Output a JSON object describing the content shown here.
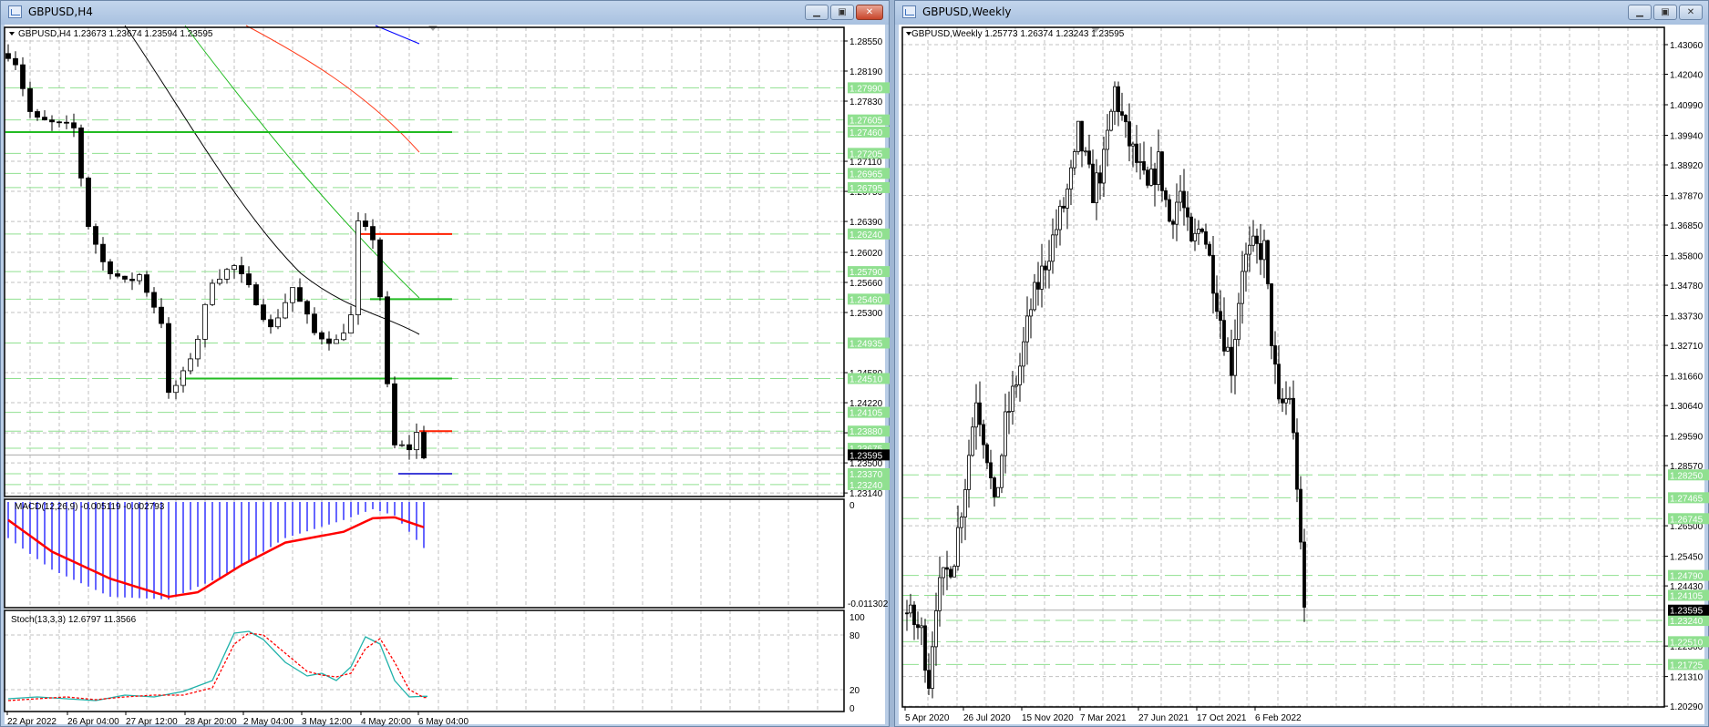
{
  "left_window": {
    "title": "GBPUSD,H4",
    "buttons": {
      "minimize": "▁",
      "restore": "▣",
      "close": "✕"
    },
    "info": "GBPUSD,H4  1.23673 1.23674 1.23594 1.23595",
    "price_ticks": [
      "1.28550",
      "1.28190",
      "1.27830",
      "1.27110",
      "1.26750",
      "1.26390",
      "1.26020",
      "1.25660",
      "1.25300",
      "1.24580",
      "1.24220",
      "1.23860",
      "1.23500",
      "1.23140"
    ],
    "level_labels": [
      "1.27990",
      "1.27605",
      "1.27460",
      "1.27205",
      "1.26965",
      "1.26795",
      "1.26240",
      "1.25790",
      "1.25460",
      "1.24935",
      "1.24510",
      "1.24105",
      "1.23880",
      "1.23675",
      "1.23370",
      "1.23240"
    ],
    "current_price": "1.23595",
    "time_labels": [
      "22 Apr 2022",
      "26 Apr 04:00",
      "27 Apr 12:00",
      "28 Apr 20:00",
      "2 May 04:00",
      "3 May 12:00",
      "4 May 20:00",
      "6 May 04:00"
    ],
    "price_path": [
      [
        0,
        1.284
      ],
      [
        1,
        1.283
      ],
      [
        3,
        1.277
      ],
      [
        4,
        1.276
      ],
      [
        9,
        1.275
      ],
      [
        11,
        1.2635
      ],
      [
        13,
        1.259
      ],
      [
        16,
        1.2565
      ],
      [
        18,
        1.2575
      ],
      [
        21,
        1.252
      ],
      [
        22,
        1.243
      ],
      [
        24,
        1.2455
      ],
      [
        26,
        1.25
      ],
      [
        28,
        1.257
      ],
      [
        31,
        1.2585
      ],
      [
        34,
        1.2545
      ],
      [
        36,
        1.251
      ],
      [
        39,
        1.256
      ],
      [
        42,
        1.2505
      ],
      [
        45,
        1.2495
      ],
      [
        47,
        1.2525
      ],
      [
        48,
        1.2635
      ],
      [
        50,
        1.262
      ],
      [
        51,
        1.255
      ],
      [
        52,
        1.244
      ],
      [
        53,
        1.237
      ],
      [
        55,
        1.2368
      ],
      [
        56,
        1.2385
      ],
      [
        57,
        1.23595
      ]
    ],
    "candle_count": 58,
    "macd": {
      "label": "MACD(12,26,9) -0.005119 -0.002793",
      "axis_top": "0",
      "axis_bottom": "-0.011302",
      "hist_path": [
        [
          0,
          -0.004
        ],
        [
          6,
          -0.0075
        ],
        [
          14,
          -0.0105
        ],
        [
          22,
          -0.0108
        ],
        [
          30,
          -0.008
        ],
        [
          38,
          -0.004
        ],
        [
          46,
          -0.002
        ],
        [
          50,
          -0.0008
        ],
        [
          53,
          -0.0015
        ],
        [
          57,
          -0.0051
        ]
      ],
      "signal_path": [
        [
          0,
          -0.002
        ],
        [
          6,
          -0.0055
        ],
        [
          14,
          -0.0085
        ],
        [
          22,
          -0.0105
        ],
        [
          26,
          -0.01
        ],
        [
          32,
          -0.007
        ],
        [
          38,
          -0.0045
        ],
        [
          46,
          -0.0033
        ],
        [
          50,
          -0.0018
        ],
        [
          53,
          -0.0017
        ],
        [
          57,
          -0.0028
        ]
      ]
    },
    "stoch": {
      "label": "Stoch(13,3,3) 12.6797 11.3566",
      "axis_labels": [
        "100",
        "80",
        "20",
        "0"
      ],
      "main_path": [
        [
          0,
          10
        ],
        [
          4,
          12
        ],
        [
          8,
          10
        ],
        [
          12,
          8
        ],
        [
          16,
          14
        ],
        [
          20,
          12
        ],
        [
          24,
          18
        ],
        [
          28,
          30
        ],
        [
          31,
          82
        ],
        [
          33,
          84
        ],
        [
          35,
          75
        ],
        [
          38,
          50
        ],
        [
          41,
          35
        ],
        [
          43,
          38
        ],
        [
          45,
          30
        ],
        [
          47,
          45
        ],
        [
          49,
          78
        ],
        [
          51,
          70
        ],
        [
          53,
          30
        ],
        [
          55,
          12
        ],
        [
          57,
          12.68
        ]
      ],
      "signal_path": [
        [
          0,
          8
        ],
        [
          4,
          10
        ],
        [
          8,
          12
        ],
        [
          12,
          9
        ],
        [
          16,
          12
        ],
        [
          20,
          14
        ],
        [
          24,
          14
        ],
        [
          28,
          22
        ],
        [
          31,
          70
        ],
        [
          33,
          82
        ],
        [
          35,
          80
        ],
        [
          38,
          60
        ],
        [
          41,
          40
        ],
        [
          43,
          36
        ],
        [
          45,
          34
        ],
        [
          47,
          38
        ],
        [
          49,
          65
        ],
        [
          51,
          76
        ],
        [
          53,
          50
        ],
        [
          55,
          20
        ],
        [
          57,
          11.36
        ]
      ]
    }
  },
  "right_window": {
    "title": "GBPUSD,Weekly",
    "buttons": {
      "minimize": "▁",
      "restore": "▣",
      "close": "✕"
    },
    "info": "GBPUSD,Weekly  1.25773 1.26374 1.23243 1.23595",
    "price_ticks": [
      "1.43060",
      "1.42040",
      "1.40990",
      "1.39940",
      "1.38920",
      "1.37870",
      "1.36850",
      "1.35800",
      "1.34780",
      "1.33730",
      "1.32710",
      "1.31660",
      "1.30640",
      "1.29590",
      "1.28570",
      "1.26500",
      "1.25450",
      "1.24430",
      "1.22360",
      "1.21310",
      "1.20290"
    ],
    "level_labels": [
      "1.28250",
      "1.27465",
      "1.26745",
      "1.24790",
      "1.24105",
      "1.23240",
      "1.22510",
      "1.21725"
    ],
    "current_price": "1.23595",
    "time_labels": [
      "5 Apr 2020",
      "26 Jul 2020",
      "15 Nov 2020",
      "7 Mar 2021",
      "27 Jun 2021",
      "17 Oct 2021",
      "6 Feb 2022"
    ],
    "price_path": [
      [
        0,
        1.235
      ],
      [
        4,
        1.228
      ],
      [
        6,
        1.212
      ],
      [
        8,
        1.24
      ],
      [
        13,
        1.255
      ],
      [
        16,
        1.28
      ],
      [
        19,
        1.31
      ],
      [
        22,
        1.29
      ],
      [
        24,
        1.27
      ],
      [
        27,
        1.3
      ],
      [
        31,
        1.32
      ],
      [
        34,
        1.34
      ],
      [
        39,
        1.36
      ],
      [
        43,
        1.375
      ],
      [
        46,
        1.39
      ],
      [
        47,
        1.4
      ],
      [
        51,
        1.38
      ],
      [
        54,
        1.39
      ],
      [
        57,
        1.415
      ],
      [
        60,
        1.4
      ],
      [
        63,
        1.39
      ],
      [
        66,
        1.38
      ],
      [
        69,
        1.39
      ],
      [
        72,
        1.37
      ],
      [
        75,
        1.38
      ],
      [
        78,
        1.36
      ],
      [
        81,
        1.37
      ],
      [
        84,
        1.35
      ],
      [
        87,
        1.33
      ],
      [
        89,
        1.32
      ],
      [
        92,
        1.355
      ],
      [
        95,
        1.36
      ],
      [
        98,
        1.36
      ],
      [
        100,
        1.33
      ],
      [
        102,
        1.305
      ],
      [
        105,
        1.31
      ],
      [
        107,
        1.28
      ],
      [
        108,
        1.255
      ],
      [
        109,
        1.23595
      ]
    ],
    "candle_count": 110
  },
  "colors": {
    "bull": "#ffffff",
    "bear": "#000000",
    "level_green": "#90e090",
    "grid": "#c0c0c0",
    "macd_hist": "#0000ff",
    "macd_signal": "#ff0000",
    "stoch_main": "#20b2aa",
    "stoch_signal": "#ff0000"
  }
}
